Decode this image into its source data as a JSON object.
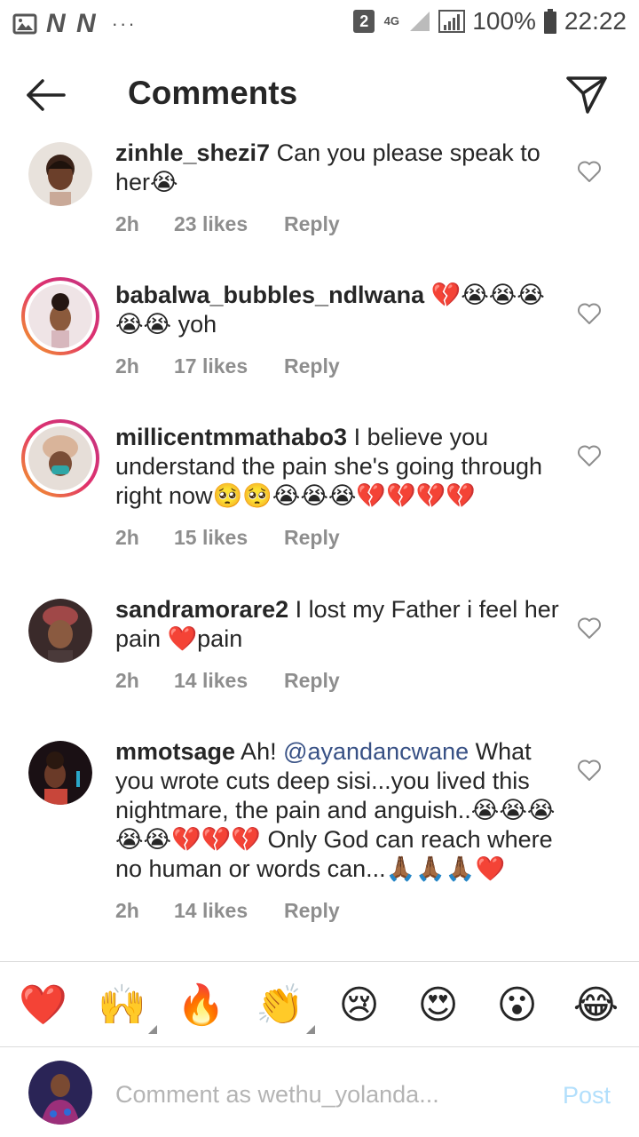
{
  "statusbar": {
    "carrier_marks": "N N",
    "more": "···",
    "sim": "2",
    "network": "4G",
    "battery": "100%",
    "time": "22:22"
  },
  "header": {
    "title": "Comments"
  },
  "comments": [
    {
      "username": "zinhle_shezi7",
      "text": " Can you please speak to her😭",
      "time": "2h",
      "likes": "23 likes",
      "reply": "Reply"
    },
    {
      "username": "babalwa_bubbles_ndlwana",
      "text": " 💔😭😭😭😭😭 yoh",
      "time": "2h",
      "likes": "17 likes",
      "reply": "Reply"
    },
    {
      "username": "millicentmmathabo3",
      "text": " I believe you understand the pain she's going through right now🥺🥺😭😭😭💔💔💔💔",
      "time": "2h",
      "likes": "15 likes",
      "reply": "Reply"
    },
    {
      "username": "sandramorare2",
      "text": " I lost my Father i feel her pain ❤️pain",
      "time": "2h",
      "likes": "14 likes",
      "reply": "Reply"
    },
    {
      "username": "mmotsage",
      "text_before": " Ah! ",
      "mention": "@ayandancwane",
      "text": " What you wrote cuts deep sisi...you lived this nightmare, the pain and anguish..😭😭😭😭😭💔💔💔 Only God can reach where no human or words can...🙏🏾🙏🏾🙏🏾❤️",
      "time": "2h",
      "likes": "14 likes",
      "reply": "Reply"
    }
  ],
  "reactions": [
    "❤️",
    "🙌",
    "🔥",
    "👏",
    "😢",
    "😍",
    "😮",
    "😂"
  ],
  "composer": {
    "placeholder": "Comment as wethu_yolanda...",
    "post_label": "Post"
  },
  "colors": {
    "text": "#262626",
    "meta": "#8e8e8e",
    "mention": "#385185",
    "post_disabled": "#b2dffc",
    "story_ring_start": "#f5a623",
    "story_ring_end": "#c13584"
  }
}
